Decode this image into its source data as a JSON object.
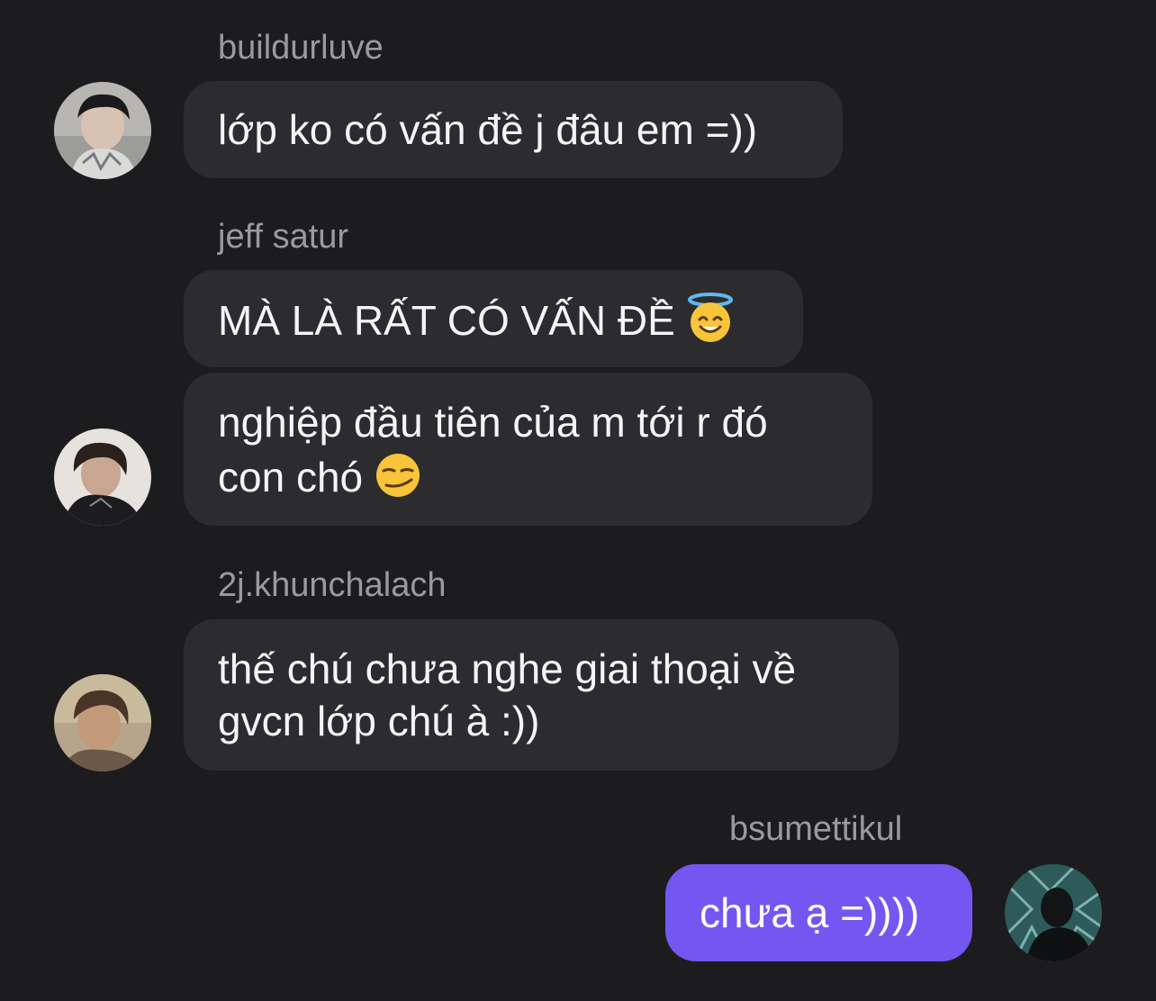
{
  "messages": [
    {
      "sender": "buildurluve",
      "text": "lớp ko có vấn đề j đâu em =))"
    },
    {
      "sender": "jeff satur",
      "text1": "MÀ LÀ RẤT CÓ VẤN ĐỀ",
      "text1_emoji": "smiling-face-with-halo-emoji",
      "text2_line1": "nghiệp đầu tiên của m tới r đó",
      "text2_line2": "con chó",
      "text2_emoji": "smirking-face-emoji"
    },
    {
      "sender": "2j.khunchalach",
      "line1": "thế chú chưa nghe giai thoại về",
      "line2": "gvcn lớp chú à :))"
    },
    {
      "sender": "bsumettikul",
      "text": "chưa ạ =))))"
    }
  ],
  "colors": {
    "background": "#1c1c1e",
    "incoming_bubble": "#2c2c2e",
    "outgoing_bubble": "#7357f0",
    "sender_name": "#9a9a9e"
  }
}
